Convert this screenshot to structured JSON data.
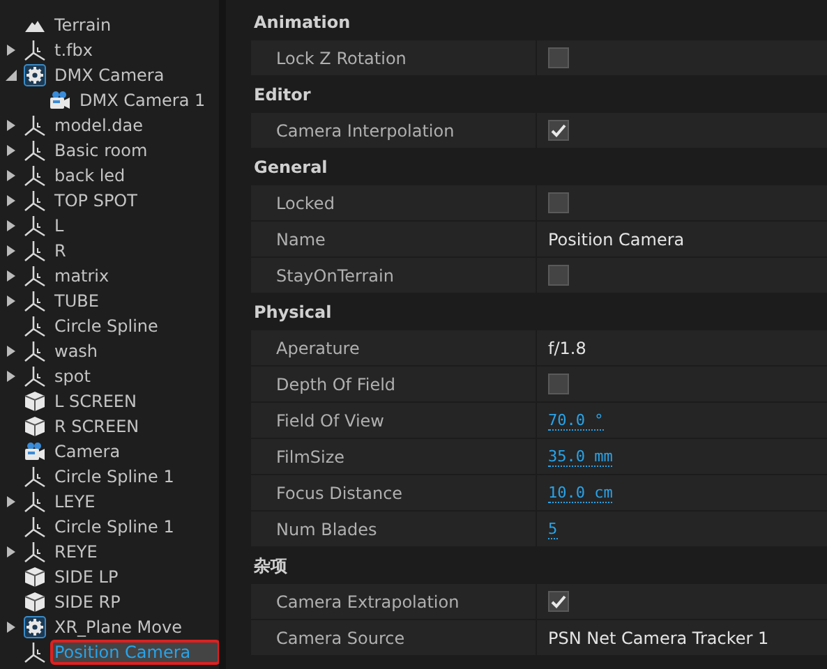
{
  "tree": [
    {
      "label": "Terrain",
      "kind": "terrain",
      "selected": false
    },
    {
      "label": "t.fbx",
      "kind": "axes",
      "expanded": false,
      "selected": false
    },
    {
      "label": "DMX Camera",
      "kind": "gear",
      "expanded": true,
      "selected": false,
      "children": [
        {
          "label": "DMX Camera 1",
          "kind": "camera",
          "selected": false
        }
      ]
    },
    {
      "label": "model.dae",
      "kind": "axes",
      "expanded": false,
      "selected": false
    },
    {
      "label": "Basic room",
      "kind": "axes",
      "expanded": false,
      "selected": false
    },
    {
      "label": "back led",
      "kind": "axes",
      "expanded": false,
      "selected": false
    },
    {
      "label": "TOP SPOT",
      "kind": "axes",
      "expanded": false,
      "selected": false
    },
    {
      "label": "L",
      "kind": "axes",
      "expanded": false,
      "selected": false
    },
    {
      "label": "R",
      "kind": "axes",
      "expanded": false,
      "selected": false
    },
    {
      "label": "matrix",
      "kind": "axes",
      "expanded": false,
      "selected": false
    },
    {
      "label": "TUBE",
      "kind": "axes",
      "expanded": false,
      "selected": false
    },
    {
      "label": "Circle Spline",
      "kind": "axes",
      "selected": false
    },
    {
      "label": "wash",
      "kind": "axes",
      "expanded": false,
      "selected": false
    },
    {
      "label": "spot",
      "kind": "axes",
      "expanded": false,
      "selected": false
    },
    {
      "label": "L SCREEN",
      "kind": "cube",
      "selected": false
    },
    {
      "label": "R SCREEN",
      "kind": "cube",
      "selected": false
    },
    {
      "label": "Camera",
      "kind": "camera",
      "selected": false
    },
    {
      "label": "Circle Spline 1",
      "kind": "axes",
      "selected": false
    },
    {
      "label": "LEYE",
      "kind": "axes",
      "expanded": false,
      "selected": false
    },
    {
      "label": "Circle Spline 1",
      "kind": "axes",
      "selected": false
    },
    {
      "label": "REYE",
      "kind": "axes",
      "expanded": false,
      "selected": false
    },
    {
      "label": "SIDE LP",
      "kind": "cube",
      "selected": false
    },
    {
      "label": "SIDE RP",
      "kind": "cube",
      "selected": false
    },
    {
      "label": "XR_Plane Move",
      "kind": "gear",
      "expanded": false,
      "selected": false
    },
    {
      "label": "Position Camera",
      "kind": "axes",
      "selected": true
    }
  ],
  "properties": [
    {
      "title": "Animation",
      "rows": [
        {
          "label": "Lock Z Rotation",
          "kind": "checkbox",
          "checked": false
        }
      ]
    },
    {
      "title": "Editor",
      "rows": [
        {
          "label": "Camera Interpolation",
          "kind": "checkbox",
          "checked": true
        }
      ]
    },
    {
      "title": "General",
      "rows": [
        {
          "label": "Locked",
          "kind": "checkbox",
          "checked": false
        },
        {
          "label": "Name",
          "kind": "text",
          "value": "Position Camera"
        },
        {
          "label": "StayOnTerrain",
          "kind": "checkbox",
          "checked": false
        }
      ]
    },
    {
      "title": "Physical",
      "rows": [
        {
          "label": "Aperature",
          "kind": "text",
          "value": "f/1.8"
        },
        {
          "label": "Depth Of Field",
          "kind": "checkbox",
          "checked": false
        },
        {
          "label": "Field Of View",
          "kind": "number",
          "value": "70.0 °"
        },
        {
          "label": "FilmSize",
          "kind": "number",
          "value": "35.0 mm"
        },
        {
          "label": "Focus Distance",
          "kind": "number",
          "value": "10.0 cm"
        },
        {
          "label": "Num Blades",
          "kind": "number",
          "value": "5"
        }
      ]
    },
    {
      "title": "杂项",
      "rows": [
        {
          "label": "Camera Extrapolation",
          "kind": "checkbox",
          "checked": true
        },
        {
          "label": "Camera Source",
          "kind": "text",
          "value": "PSN Net Camera Tracker 1"
        }
      ]
    }
  ]
}
